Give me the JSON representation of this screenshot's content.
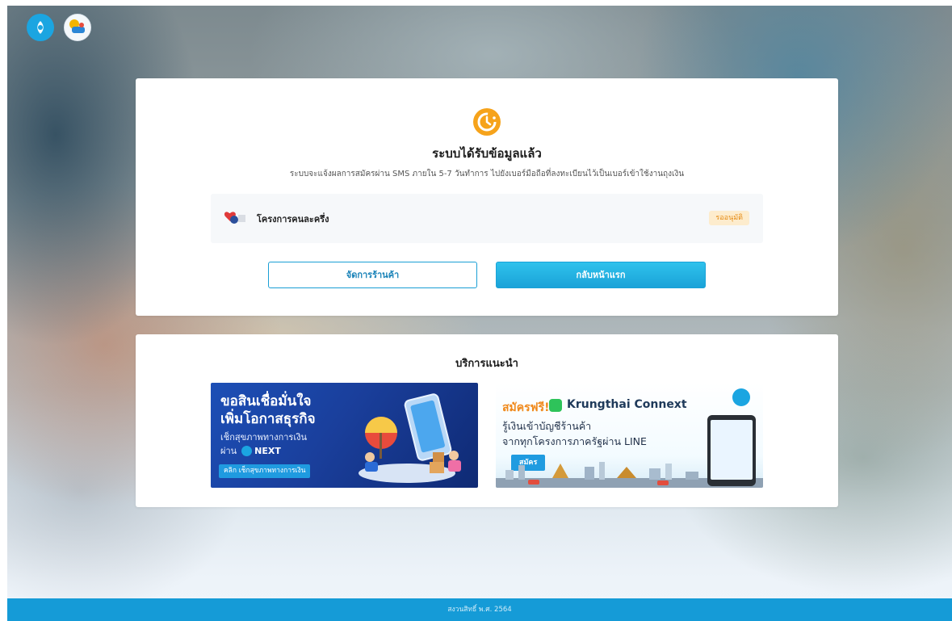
{
  "header": {
    "logo_primary_icon": "krungthai-logo-icon",
    "logo_secondary_icon": "project-logo-icon"
  },
  "result": {
    "status_icon": "clock-pending-icon",
    "title": "ระบบได้รับข้อมูลแล้ว",
    "subtitle": "ระบบจะแจ้งผลการสมัครผ่าน SMS ภายใน 5-7 วันทำการ ไปยังเบอร์มือถือที่ลงทะเบียนไว้เป็นเบอร์เข้าใช้งานถุงเงิน",
    "project": {
      "icon": "half-half-project-icon",
      "name": "โครงการคนละครึ่ง",
      "status": "รออนุมัติ"
    },
    "buttons": {
      "manage_shop": "จัดการร้านค้า",
      "back_home": "กลับหน้าแรก"
    }
  },
  "recommend": {
    "title": "บริการแนะนำ",
    "banner_loan": {
      "line1": "ขอสินเชื่อมั่นใจ",
      "line2": "เพิ่มโอกาสธุรกิจ",
      "line3": "เช็กสุขภาพทางการเงิน",
      "line4_prefix": "ผ่าน",
      "app_name": "NEXT",
      "cta": "คลิก เช็กสุขภาพทางการเงิน"
    },
    "banner_connext": {
      "free": "สมัครฟรี!",
      "brand": "Krungthai Connext",
      "line1": "รู้เงินเข้าบัญชีร้านค้า",
      "line2": "จากทุกโครงการภาครัฐผ่าน LINE",
      "cta": "สมัคร"
    }
  },
  "footer": {
    "copyright": "สงวนสิทธิ์ พ.ศ. 2564"
  },
  "colors": {
    "primary": "#1aa3d8",
    "status_pending_bg": "#fdeccd",
    "status_pending_text": "#e58a12",
    "footer_bg": "#159bd7",
    "status_icon": "#f6a31b"
  }
}
